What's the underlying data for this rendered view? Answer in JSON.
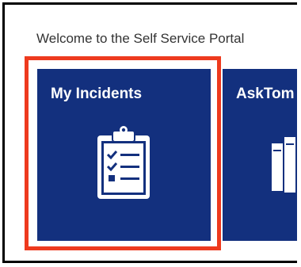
{
  "portal": {
    "welcome_text": "Welcome to the Self Service Portal"
  },
  "tiles": [
    {
      "label": "My Incidents",
      "icon": "clipboard-checklist-icon",
      "highlighted": true
    },
    {
      "label": "AskTom",
      "icon": "books-icon"
    }
  ],
  "colors": {
    "tile_background": "#13307e",
    "highlight_border": "#ee3a1e",
    "frame_border": "#000000"
  }
}
